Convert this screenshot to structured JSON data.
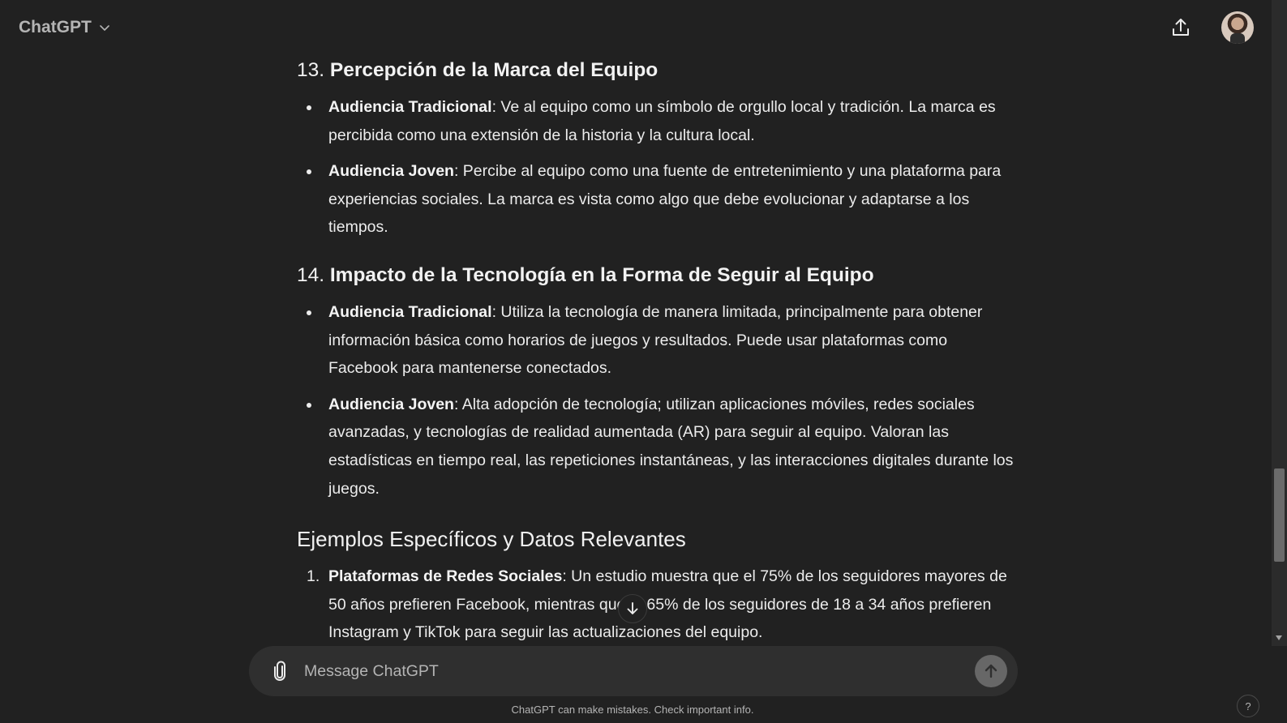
{
  "header": {
    "model_name": "ChatGPT"
  },
  "sections": {
    "s13": {
      "number": "13.",
      "title": "Percepción de la Marca del Equipo",
      "items": [
        {
          "label": "Audiencia Tradicional",
          "text": ": Ve al equipo como un símbolo de orgullo local y tradición. La marca es percibida como una extensión de la historia y la cultura local."
        },
        {
          "label": "Audiencia Joven",
          "text": ": Percibe al equipo como una fuente de entretenimiento y una plataforma para experiencias sociales. La marca es vista como algo que debe evolucionar y adaptarse a los tiempos."
        }
      ]
    },
    "s14": {
      "number": "14.",
      "title": "Impacto de la Tecnología en la Forma de Seguir al Equipo",
      "items": [
        {
          "label": "Audiencia Tradicional",
          "text": ": Utiliza la tecnología de manera limitada, principalmente para obtener información básica como horarios de juegos y resultados. Puede usar plataformas como Facebook para mantenerse conectados."
        },
        {
          "label": "Audiencia Joven",
          "text": ": Alta adopción de tecnología; utilizan aplicaciones móviles, redes sociales avanzadas, y tecnologías de realidad aumentada (AR) para seguir al equipo. Valoran las estadísticas en tiempo real, las repeticiones instantáneas, y las interacciones digitales durante los juegos."
        }
      ]
    },
    "examples": {
      "title": "Ejemplos Específicos y Datos Relevantes",
      "items": [
        {
          "marker": "1.",
          "label": "Plataformas de Redes Sociales",
          "text": ": Un estudio muestra que el 75% de los seguidores mayores de 50 años prefieren Facebook, mientras que el 65% de los seguidores de 18 a 34 años prefieren Instagram y TikTok para seguir las actualizaciones del equipo."
        }
      ]
    }
  },
  "composer": {
    "placeholder": "Message ChatGPT"
  },
  "footer": {
    "disclaimer": "ChatGPT can make mistakes. Check important info.",
    "help_label": "?"
  },
  "icons": {
    "model_menu": "chevron-down-icon",
    "share": "share-icon",
    "attach": "paperclip-icon",
    "send": "arrow-up-icon",
    "scroll_down": "arrow-down-icon"
  },
  "colors": {
    "background": "#212121",
    "composer": "#2f2f2f",
    "text": "#ececec",
    "muted": "#b4b4b4",
    "send_button": "#676767"
  }
}
